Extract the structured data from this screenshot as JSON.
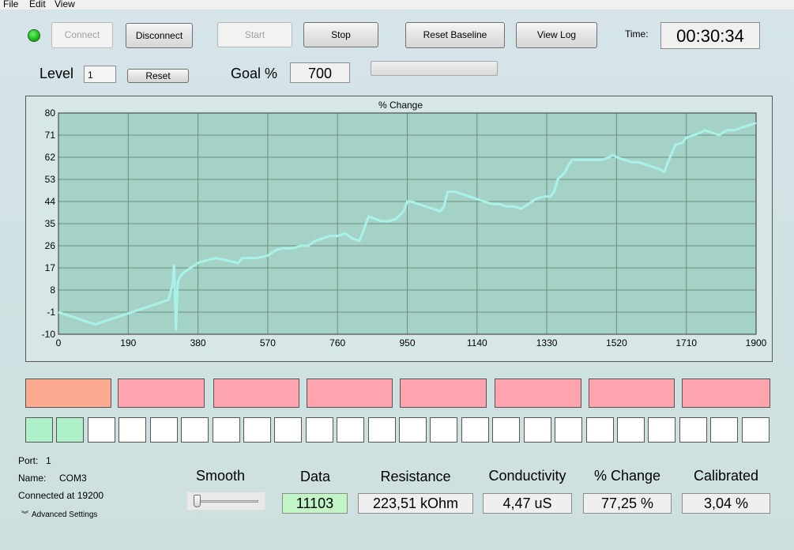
{
  "menu": {
    "file": "File",
    "edit": "Edit",
    "view": "View"
  },
  "toolbar": {
    "connect": "Connect",
    "disconnect": "Disconnect",
    "start": "Start",
    "stop": "Stop",
    "reset_baseline": "Reset Baseline",
    "view_log": "View Log",
    "time_label": "Time:",
    "time_value": "00:30:34"
  },
  "level_row": {
    "level_label": "Level",
    "level_value": "1",
    "reset": "Reset",
    "goal_label": "Goal %",
    "goal_value": "700",
    "progress": 0.0
  },
  "status_colors": {
    "connected": "#1fc11f",
    "segment_active": "#fbaa90",
    "segment": "#fda4ae",
    "square_filled": "#aef0c8",
    "square_empty": "#ffffff",
    "data_field": "#c2f5c6",
    "plot_bg": "#a5d2c6",
    "line": "#a8f2ea"
  },
  "chart_data": {
    "type": "line",
    "title": "% Change",
    "xlabel": "",
    "ylabel": "",
    "xlim": [
      0,
      1900
    ],
    "ylim": [
      -10,
      80
    ],
    "xticks": [
      0,
      190,
      380,
      570,
      760,
      950,
      1140,
      1330,
      1520,
      1710,
      1900
    ],
    "yticks": [
      -10,
      -1,
      8,
      17,
      26,
      35,
      44,
      53,
      62,
      71,
      80
    ],
    "x": [
      0,
      20,
      40,
      60,
      80,
      100,
      120,
      140,
      160,
      180,
      200,
      220,
      240,
      260,
      280,
      300,
      310,
      315,
      320,
      325,
      330,
      340,
      360,
      380,
      400,
      430,
      460,
      490,
      500,
      520,
      540,
      570,
      590,
      610,
      640,
      660,
      680,
      700,
      720,
      740,
      760,
      780,
      800,
      820,
      840,
      845,
      860,
      880,
      900,
      920,
      940,
      950,
      960,
      980,
      1000,
      1020,
      1040,
      1050,
      1060,
      1080,
      1100,
      1120,
      1140,
      1160,
      1180,
      1200,
      1220,
      1240,
      1260,
      1280,
      1300,
      1320,
      1340,
      1350,
      1360,
      1380,
      1390,
      1400,
      1420,
      1440,
      1460,
      1480,
      1500,
      1510,
      1520,
      1540,
      1560,
      1580,
      1600,
      1620,
      1640,
      1650,
      1660,
      1680,
      1700,
      1710,
      1730,
      1750,
      1760,
      1780,
      1800,
      1820,
      1840,
      1860,
      1880,
      1900
    ],
    "y": [
      -1,
      -2,
      -3,
      -4,
      -5,
      -6,
      -5,
      -4,
      -3,
      -2,
      -1,
      0,
      1,
      2,
      3,
      4,
      10,
      18,
      -8,
      11,
      13,
      15,
      17,
      19,
      20,
      21,
      20,
      19,
      21,
      21,
      21,
      22,
      24,
      25,
      25,
      26,
      26,
      28,
      29,
      30,
      30,
      31,
      29,
      28,
      36,
      38,
      37,
      36,
      36,
      37,
      40,
      44,
      44,
      43,
      42,
      41,
      40,
      42,
      48,
      48,
      47,
      46,
      45,
      44,
      43,
      43,
      42,
      42,
      41,
      43,
      45,
      46,
      46,
      48,
      53,
      56,
      59,
      61,
      61,
      61,
      61,
      61,
      62,
      63,
      62,
      61,
      60,
      60,
      59,
      58,
      57,
      56,
      60,
      67,
      68,
      70,
      71,
      72,
      73,
      72,
      71,
      73,
      73,
      74,
      75,
      76,
      76
    ]
  },
  "connection": {
    "port_label": "Port:",
    "port_value": "1",
    "name_label": "Name:",
    "name_value": "COM3",
    "connected_text": "Connected at 19200",
    "advanced_settings": "Advanced Settings"
  },
  "readouts": {
    "smooth_label": "Smooth",
    "smooth_value": 0.0,
    "data_label": "Data",
    "data_value": "11103",
    "resistance_label": "Resistance",
    "resistance_value": "223,51 kOhm",
    "conductivity_label": "Conductivity",
    "conductivity_value": "4,47 uS",
    "change_label": "% Change",
    "change_value": "77,25 %",
    "calibrated_label": "Calibrated",
    "calibrated_value": "3,04 %"
  },
  "level_indicators": {
    "segments_total": 8,
    "segments_active": 1,
    "squares_total": 24,
    "squares_filled": 2
  }
}
